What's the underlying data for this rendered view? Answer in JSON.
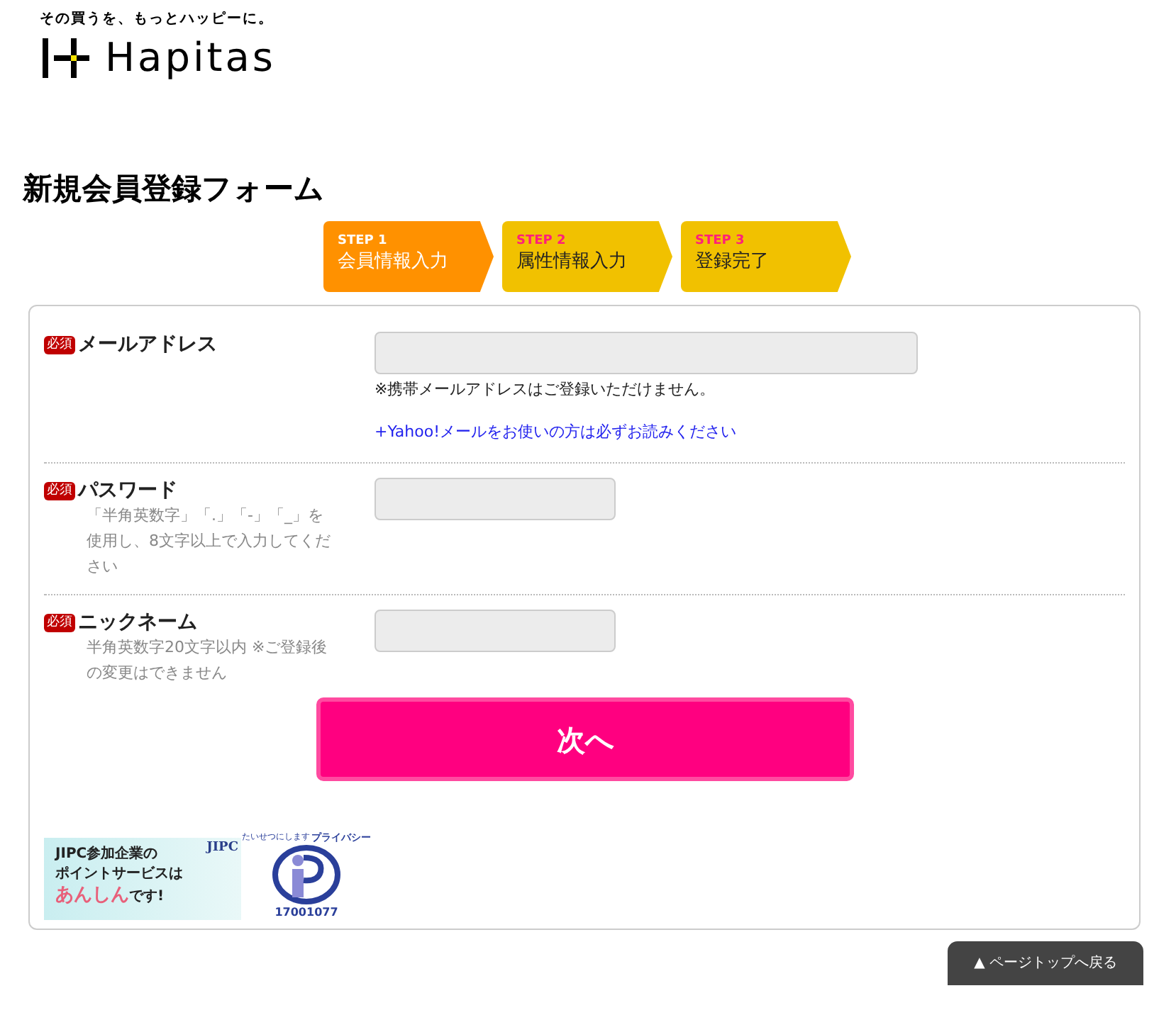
{
  "header": {
    "tagline": "その買うを、もっとハッピーに。",
    "logo_text": "Hapitas"
  },
  "title": "新規会員登録フォーム",
  "steps": [
    {
      "step": "STEP 1",
      "name": "会員情報入力",
      "selected": true
    },
    {
      "step": "STEP 2",
      "name": "属性情報入力",
      "selected": false
    },
    {
      "step": "STEP 3",
      "name": "登録完了",
      "selected": false
    }
  ],
  "fields": [
    {
      "badge": "必須",
      "label": "メールアドレス",
      "kind": "wide",
      "note": "※携帯メールアドレスはご登録いただけません。",
      "link": "+Yahoo!メールをお使いの方は必ずお読みください"
    },
    {
      "badge": "必須",
      "label": "パスワード",
      "kind": "short",
      "help": "「半角英数字」「.」「-」「_」を使用し、8文字以上で入力してください"
    },
    {
      "badge": "必須",
      "label": "ニックネーム",
      "kind": "short",
      "help": "半角英数字20文字以内 ※ご登録後の変更はできません"
    }
  ],
  "submit": "次へ",
  "jipc_banner": {
    "lines": [
      "JIPC参加企業の",
      "ポイントサービスは"
    ],
    "emphasis": "あんしん",
    "tail": "です!",
    "brand": "JIPC"
  },
  "privacy_mark": {
    "caption": "たいせつにします",
    "brand": "プライバシー",
    "number": "17001077"
  },
  "page_top": "▲ ページトップへ戻る"
}
